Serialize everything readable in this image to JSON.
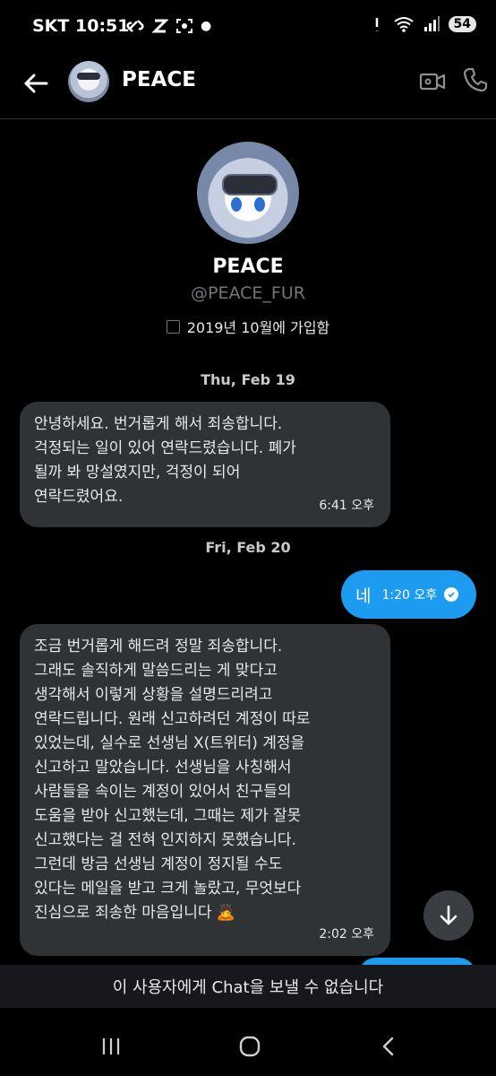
{
  "status": {
    "carrier": "SKT",
    "time": "10:51",
    "battery": "54"
  },
  "header": {
    "name": "PEACE"
  },
  "profile": {
    "name": "PEACE",
    "handle": "@PEACE_FUR",
    "joined": "2019년 10월에 가입함"
  },
  "dates": {
    "first": "Thu, Feb 19",
    "second": "Fri, Feb 20"
  },
  "messages": [
    {
      "direction": "incoming",
      "text": "안녕하세요. 번거롭게 해서 죄송합니다.\n걱정되는 일이 있어 연락드렸습니다. 폐가\n될까 봐 망설였지만, 걱정이 되어\n연락드렸어요.",
      "time": "6:41 오후"
    },
    {
      "direction": "outgoing",
      "text": "네",
      "time": "1:20 오후"
    },
    {
      "direction": "incoming",
      "text": "조금 번거롭게 해드려 정말 죄송합니다.\n그래도 솔직하게 말씀드리는 게 맞다고\n생각해서 이렇게 상황을 설명드리려고\n연락드립니다. 원래 신고하려던 계정이 따로\n있었는데, 실수로 선생님 X(트위터) 계정을\n신고하고 말았습니다. 선생님을 사칭해서\n사람들을 속이는 계정이 있어서 친구들의\n도움을 받아 신고했는데, 그때는 제가 잘못\n신고했다는 걸 전혀 인지하지 못했습니다.\n그런데 방금 선생님 계정이 정지될 수도\n있다는 메일을 받고 크게 놀랐고, 무엇보다\n진심으로 죄송한 마음입니다 🙇",
      "time": "2:02 오후"
    }
  ],
  "banner": "이 사용자에게 Chat을 보낼 수 없습니다",
  "colors": {
    "background": "#000000",
    "bubble_incoming": "#2f3336",
    "bubble_outgoing": "#1d9bf0",
    "banner": "#16181c"
  },
  "icons": [
    "back-arrow-icon",
    "video-call-icon",
    "phone-call-icon",
    "calendar-icon",
    "read-check-icon",
    "arrow-down-icon",
    "recents-icon",
    "home-icon",
    "back-icon"
  ]
}
